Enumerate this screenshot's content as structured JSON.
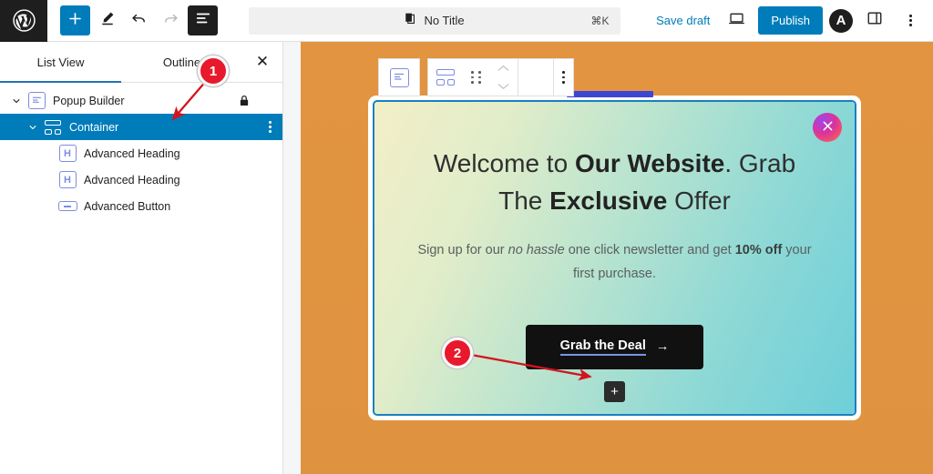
{
  "topbar": {
    "logo_icon": "wordpress-logo",
    "tools": [
      {
        "name": "add-block-button",
        "icon": "plus-icon",
        "label": "+"
      },
      {
        "name": "edit-tool-button",
        "icon": "pencil-icon",
        "label": ""
      },
      {
        "name": "undo-button",
        "icon": "undo-arrow-icon",
        "label": ""
      },
      {
        "name": "redo-button",
        "icon": "redo-arrow-icon",
        "label": ""
      },
      {
        "name": "list-view-button",
        "icon": "list-view-icon",
        "label": ""
      }
    ],
    "command_bar": {
      "title": "No Title",
      "shortcut": "⌘K",
      "icon": "document-stack-icon"
    },
    "save_draft": "Save draft",
    "preview_icon": "desktop-preview-icon",
    "publish": "Publish",
    "astra_logo": "A",
    "settings_sidebar_icon": "sidebar-toggle-icon",
    "options_icon": "three-dots-vertical-icon"
  },
  "sidebar": {
    "tabs": [
      {
        "label": "List View",
        "active": true
      },
      {
        "label": "Outline",
        "active": false
      }
    ],
    "close_label": "✕",
    "rows": [
      {
        "label": "Popup Builder",
        "icon": "popup-builder-icon",
        "indent": 1,
        "selected": false,
        "lock": true
      },
      {
        "label": "Container",
        "icon": "container-icon",
        "indent": 2,
        "selected": true,
        "dots": true
      },
      {
        "label": "Advanced Heading",
        "icon": "heading-icon",
        "indent": 3,
        "selected": false
      },
      {
        "label": "Advanced Heading",
        "icon": "heading-icon",
        "indent": 3,
        "selected": false
      },
      {
        "label": "Advanced Button",
        "icon": "button-icon",
        "indent": 3,
        "selected": false
      }
    ]
  },
  "block_toolbar": {
    "popup_icon": "popup-builder-block-icon",
    "container_icon": "container-block-icon",
    "drag_icon": "drag-handle-icon",
    "move_up_icon": "chevron-up-icon",
    "move_down_icon": "chevron-down-icon",
    "align_icon": "align-block-icon",
    "options_icon": "three-dots-vertical-icon"
  },
  "popup": {
    "close_icon": "close-circle-icon",
    "heading": {
      "part1": "Welcome to ",
      "bold1": "Our Website",
      "part2": ". Grab The ",
      "bold2": "Exclusive",
      "part3": " Offer"
    },
    "subtext": {
      "p1": "Sign up for our ",
      "em1": "no hassle",
      "p2": " one click newsletter and get ",
      "b1": "10% off",
      "p3": " your first purchase."
    },
    "cta_label": "Grab the Deal",
    "cta_arrow": "→",
    "add_block_label": "+",
    "add_block_icon": "plus-icon"
  },
  "annotations": [
    {
      "number": "1",
      "target": "container-row"
    },
    {
      "number": "2",
      "target": "add-block-button-canvas"
    }
  ],
  "colors": {
    "accent_blue": "#007cba",
    "selected_row": "#007cba",
    "canvas_bg": "#e0933f",
    "marker_red": "#e8192c",
    "cta_bg": "#111111"
  }
}
